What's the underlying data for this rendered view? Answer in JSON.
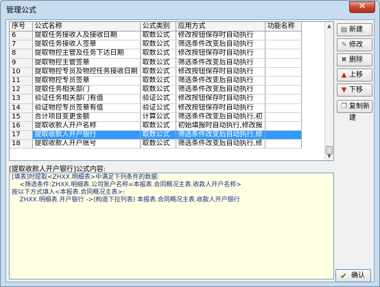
{
  "window": {
    "title": "管理公式",
    "close_glyph": "✕"
  },
  "table": {
    "columns": [
      "序号",
      "公式名称",
      "公式类别",
      "应用方式",
      "功能名称"
    ],
    "rows": [
      [
        "6",
        "提取任务接收人及接收日期",
        "取数公式",
        "修改按钮保存时自动执行",
        ""
      ],
      [
        "7",
        "提取任务接收人签章",
        "取数公式",
        "筛选条件改变后自动执行",
        ""
      ],
      [
        "8",
        "提取物控主管及任务下达日期",
        "取数公式",
        "修改按钮保存时自动执行",
        ""
      ],
      [
        "9",
        "提取物控主管签章",
        "取数公式",
        "筛选条件改变后自动执行",
        ""
      ],
      [
        "10",
        "提取物控专员及物控任务接收日期",
        "取数公式",
        "修改按钮保存时自动执行",
        ""
      ],
      [
        "11",
        "提取物控专员签章",
        "取数公式",
        "筛选条件改变后自动执行",
        ""
      ],
      [
        "12",
        "提取任务相关部门",
        "取数公式",
        "筛选条件改变后自动执行",
        ""
      ],
      [
        "13",
        "验证任务相关部门有值",
        "验证公式",
        "修改按钮保存时自动执行",
        ""
      ],
      [
        "14",
        "验证物控专员签章有值",
        "验证公式",
        "修改按钮保存时自动执行",
        ""
      ],
      [
        "15",
        "合计项目变更金额",
        "计算公式",
        "筛选条件改变后自动执行,初",
        ""
      ],
      [
        "16",
        "提取收款人开户名称",
        "取数公式",
        "初始填报时自动执行,修改报",
        ""
      ],
      [
        "17",
        "提取收款人开户银行",
        "取数公式",
        "筛选条件改变后自动执行,修",
        ""
      ],
      [
        "18",
        "提取收款人开户账号",
        "取数公式",
        "筛选条件改变后自动执行,修",
        ""
      ]
    ],
    "selected_row_index": 11,
    "scroll_up_glyph": "▲",
    "scroll_down_glyph": "▼"
  },
  "buttons": {
    "new": {
      "label": "新建",
      "icon": "new-doc-icon",
      "glyph": "▤"
    },
    "edit": {
      "label": "修改",
      "icon": "edit-icon",
      "glyph": "✎"
    },
    "delete": {
      "label": "删除",
      "icon": "delete-icon",
      "glyph": "✖"
    },
    "move_up": {
      "label": "上移",
      "icon": "arrow-up-icon",
      "glyph": "▲"
    },
    "move_down": {
      "label": "下移",
      "icon": "arrow-down-icon",
      "glyph": "▼"
    },
    "copy_new": {
      "label": "复制新建",
      "icon": "copy-icon",
      "glyph": "❐"
    },
    "ok": {
      "label": "确认",
      "icon": "check-icon",
      "glyph": "✔"
    }
  },
  "formula": {
    "label": "[提取收款人开户银行]公式内容:",
    "content": "[填表]时提取<ZHXX.明细表>中满足下列条件的数据:\n    <筛选条件:ZHXX.明细表.公司账户名称=本报表.合同概况主表.收款人开户名称>\n按以下方式填入<本报表.合同概况主表>:\n    ZHXX.明细表.开户银行 ->(构造下拉列表) 本报表.合同概况主表.收款人开户银行"
  },
  "colors": {
    "selection": "#3399ff",
    "formula_background": "#ffffe1",
    "formula_text": "#1a2a8a",
    "close_button": "#c6412b"
  }
}
